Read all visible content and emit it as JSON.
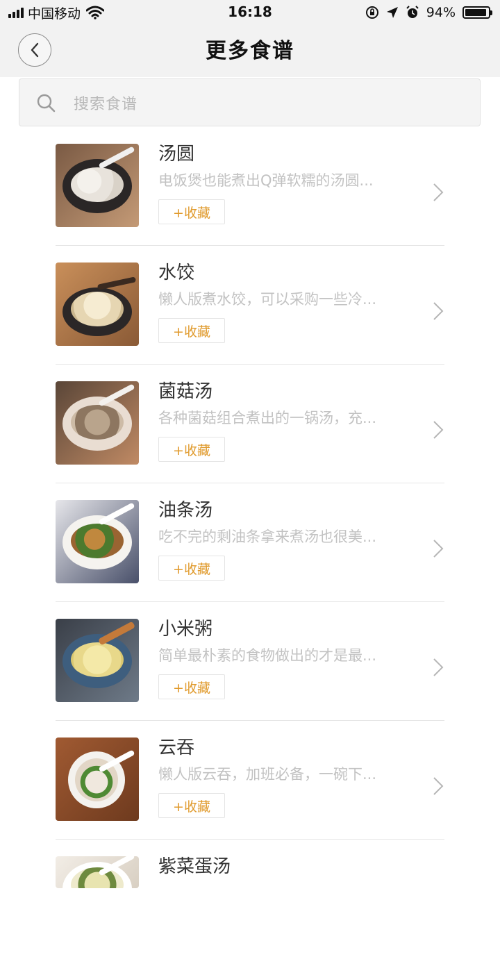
{
  "status_bar": {
    "carrier": "中国移动",
    "time": "16:18",
    "battery_percent": "94%",
    "battery_level": 0.94,
    "icons": [
      "signal-icon",
      "wifi-icon",
      "orientation-lock-icon",
      "location-icon",
      "alarm-icon",
      "battery-icon"
    ]
  },
  "header": {
    "title": "更多食谱",
    "back_icon": "chevron-left-icon"
  },
  "search": {
    "placeholder": "搜索食谱",
    "icon": "search-icon"
  },
  "colors": {
    "accent": "#e09a2c",
    "header_bg": "#f2f2f2",
    "desc_text": "#c2c2c2"
  },
  "recipes": [
    {
      "title": "汤圆",
      "desc": "电饭煲也能煮出Q弹软糯的汤圆...",
      "fav_label": "+收藏"
    },
    {
      "title": "水饺",
      "desc": "懒人版煮水饺，可以采购一些冷...",
      "fav_label": "+收藏"
    },
    {
      "title": "菌菇汤",
      "desc": "各种菌菇组合煮出的一锅汤，充...",
      "fav_label": "+收藏"
    },
    {
      "title": "油条汤",
      "desc": "吃不完的剩油条拿来煮汤也很美...",
      "fav_label": "+收藏"
    },
    {
      "title": "小米粥",
      "desc": "简单最朴素的食物做出的才是最...",
      "fav_label": "+收藏"
    },
    {
      "title": "云吞",
      "desc": "懒人版云吞，加班必备，一碗下...",
      "fav_label": "+收藏"
    },
    {
      "title": "紫菜蛋汤",
      "desc": "",
      "fav_label": ""
    }
  ]
}
